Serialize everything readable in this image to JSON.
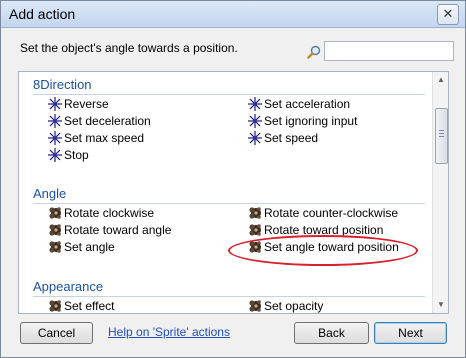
{
  "window": {
    "title": "Add action",
    "close_glyph": "✕"
  },
  "description": "Set the object's angle towards a position.",
  "search": {
    "value": "",
    "placeholder": ""
  },
  "sections": [
    {
      "name": "8Direction",
      "items": [
        {
          "label": "Reverse",
          "icon": "8direction-icon"
        },
        {
          "label": "Set acceleration",
          "icon": "8direction-icon"
        },
        {
          "label": "Set deceleration",
          "icon": "8direction-icon"
        },
        {
          "label": "Set ignoring input",
          "icon": "8direction-icon"
        },
        {
          "label": "Set max speed",
          "icon": "8direction-icon"
        },
        {
          "label": "Set speed",
          "icon": "8direction-icon"
        },
        {
          "label": "Stop",
          "icon": "8direction-icon"
        }
      ]
    },
    {
      "name": "Angle",
      "items": [
        {
          "label": "Rotate clockwise",
          "icon": "sprite-icon"
        },
        {
          "label": "Rotate counter-clockwise",
          "icon": "sprite-icon"
        },
        {
          "label": "Rotate toward angle",
          "icon": "sprite-icon"
        },
        {
          "label": "Rotate toward position",
          "icon": "sprite-icon"
        },
        {
          "label": "Set angle",
          "icon": "sprite-icon"
        },
        {
          "label": "Set angle toward position",
          "icon": "sprite-icon",
          "highlighted": true
        }
      ]
    },
    {
      "name": "Appearance",
      "items": [
        {
          "label": "Set effect",
          "icon": "sprite-icon"
        },
        {
          "label": "Set opacity",
          "icon": "sprite-icon"
        }
      ]
    }
  ],
  "footer": {
    "cancel_label": "Cancel",
    "help_label": "Help on 'Sprite' actions",
    "back_label": "Back",
    "next_label": "Next"
  },
  "colors": {
    "section_header": "#1a52a3",
    "highlight_ellipse": "#d6202b",
    "link": "#1f4fb8"
  },
  "scroll": {
    "arrow_up": "▲",
    "arrow_down": "▼"
  }
}
